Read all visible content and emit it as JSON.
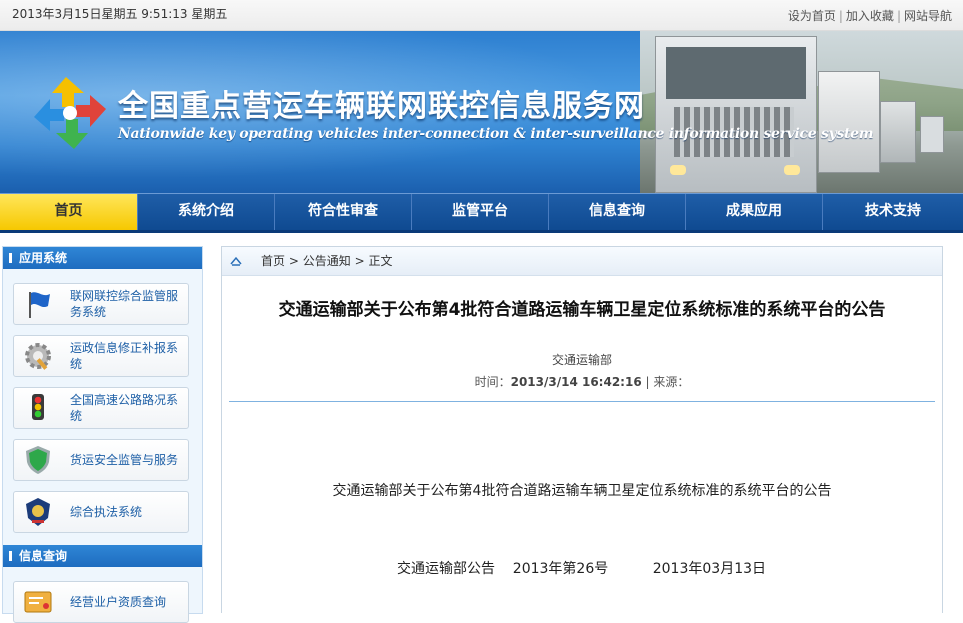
{
  "topbar": {
    "datetime": "2013年3月15日星期五 9:51:13 星期五",
    "links": [
      "设为首页",
      "加入收藏",
      "网站导航"
    ]
  },
  "banner": {
    "title_cn": "全国重点营运车辆联网联控信息服务网",
    "title_en": "Nationwide key operating vehicles inter-connection & inter-surveillance information service system"
  },
  "nav": {
    "items": [
      "首页",
      "系统介绍",
      "符合性审查",
      "监管平台",
      "信息查询",
      "成果应用",
      "技术支持"
    ],
    "active_index": 0
  },
  "sidebar": {
    "apps_header": "应用系统",
    "apps": [
      {
        "label": "联网联控综合监管服务系统",
        "icon": "flag-icon"
      },
      {
        "label": "运政信息修正补报系统",
        "icon": "gear-icon"
      },
      {
        "label": "全国高速公路路况系统",
        "icon": "traffic-light-icon"
      },
      {
        "label": "货运安全监管与服务",
        "icon": "shield-icon"
      },
      {
        "label": "综合执法系统",
        "icon": "police-badge-icon"
      }
    ],
    "query_header": "信息查询",
    "queries": [
      {
        "label": "经营业户资质查询",
        "icon": "certificate-icon"
      }
    ]
  },
  "breadcrumb": {
    "home": "首页",
    "section": "公告通知",
    "current": "正文",
    "separator": ">"
  },
  "article": {
    "title": "交通运输部关于公布第4批符合道路运输车辆卫星定位系统标准的系统平台的公告",
    "source": "交通运输部",
    "time_label": "时间：",
    "time_value": "2013/3/14 16:42:16",
    "meta_sep": "|",
    "origin_label": "来源：",
    "body_title": "交通运输部关于公布第4批符合道路运输车辆卫星定位系统标准的系统平台的公告",
    "notice_line": "交通运输部公告    2013年第26号          2013年03月13日"
  },
  "colors": {
    "nav_bg": "#1f5ea8",
    "nav_active": "#f6c800",
    "side_header": "#2f86d6",
    "link_blue": "#1d5fa6",
    "rule": "#7fb2e0"
  }
}
